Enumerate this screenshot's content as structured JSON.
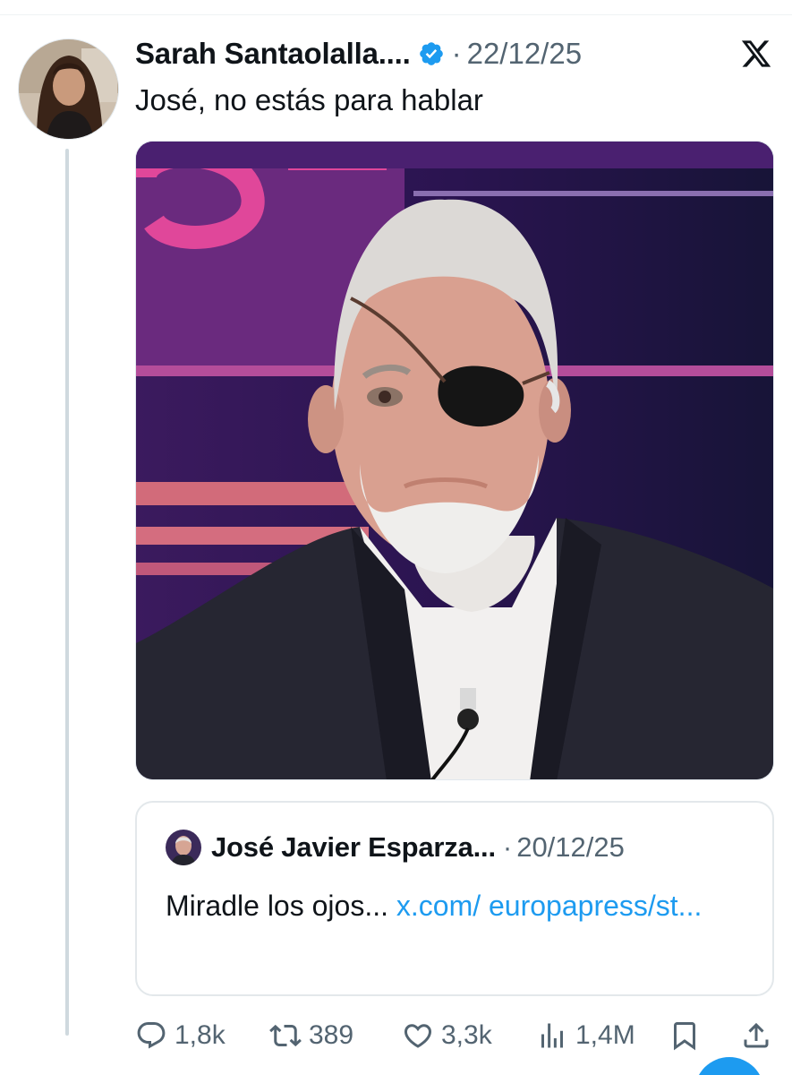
{
  "tweet": {
    "author_name": "Sarah Santaolalla....",
    "verified": true,
    "separator": "·",
    "date": "22/12/25",
    "text": "José, no estás para hablar",
    "platform_icon": "x-logo-icon",
    "media_icon": "photo"
  },
  "quoted_tweet": {
    "author_name": "José Javier Esparza...",
    "separator": "·",
    "date": "20/12/25",
    "text": "Miradle los ojos...",
    "link_text": "x.com/ europapress/st..."
  },
  "actions": {
    "replies": "1,8k",
    "reposts": "389",
    "likes": "3,3k",
    "views": "1,4M",
    "bookmark_icon": "bookmark-icon",
    "share_icon": "share-icon"
  },
  "colors": {
    "accent": "#1d9bf0",
    "text": "#0f1419",
    "secondary": "#536471",
    "border": "#e3e8eb"
  }
}
